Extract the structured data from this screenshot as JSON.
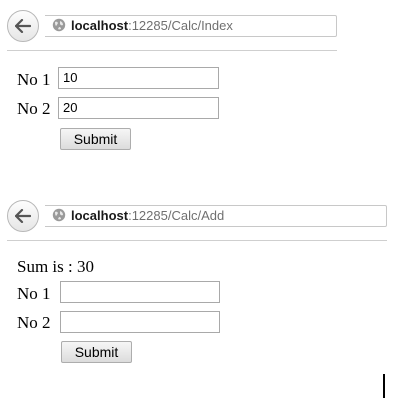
{
  "window1": {
    "url_host": "localhost",
    "url_path": ":12285/Calc/Index",
    "form": {
      "no1_label": "No 1",
      "no1_value": "10",
      "no2_label": "No 2",
      "no2_value": "20",
      "submit_label": "Submit"
    }
  },
  "window2": {
    "url_host": "localhost",
    "url_path": ":12285/Calc/Add",
    "result_text": "Sum is : 30",
    "form": {
      "no1_label": "No 1",
      "no1_value": "",
      "no2_label": "No 2",
      "no2_value": "",
      "submit_label": "Submit"
    }
  },
  "icons": {
    "back": "back-arrow-icon",
    "site": "globe-icon"
  },
  "colors": {
    "url_path": "#707070",
    "border": "#a9a9a9"
  }
}
